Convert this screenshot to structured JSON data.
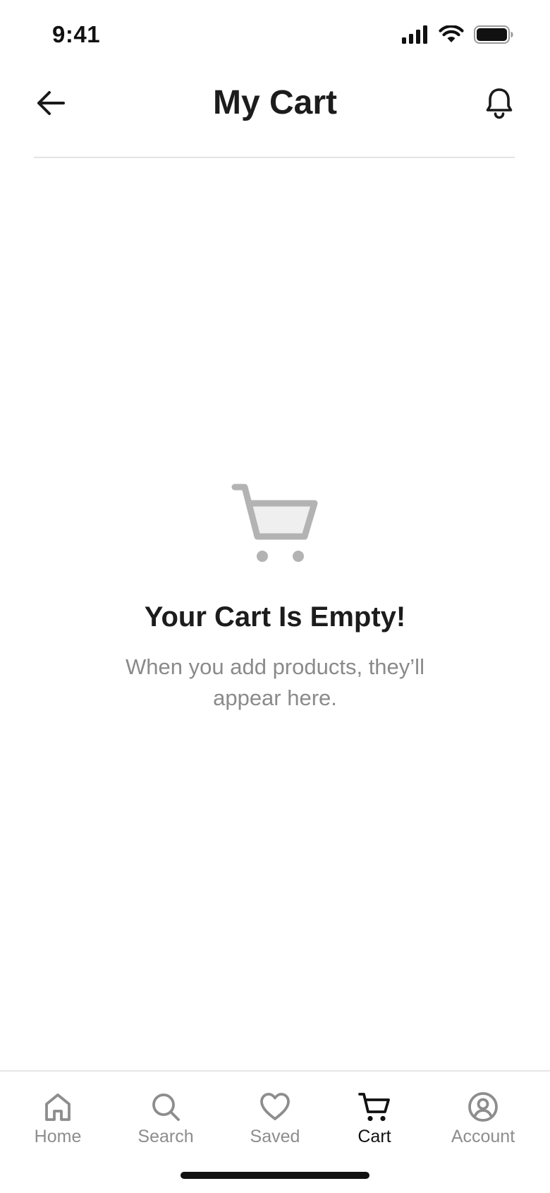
{
  "status_bar": {
    "time": "9:41",
    "icons": [
      "cellular-signal-icon",
      "wifi-icon",
      "battery-icon"
    ]
  },
  "header": {
    "title": "My Cart",
    "back_icon": "arrow-left-icon",
    "notification_icon": "bell-icon"
  },
  "empty_state": {
    "icon": "shopping-cart-icon",
    "title": "Your Cart Is Empty!",
    "subtitle": "When you add products, they’ll appear here."
  },
  "tab_bar": {
    "tabs": [
      {
        "label": "Home",
        "icon": "home-icon",
        "active": false
      },
      {
        "label": "Search",
        "icon": "search-icon",
        "active": false
      },
      {
        "label": "Saved",
        "icon": "heart-icon",
        "active": false
      },
      {
        "label": "Cart",
        "icon": "cart-icon",
        "active": true
      },
      {
        "label": "Account",
        "icon": "account-icon",
        "active": false
      }
    ]
  },
  "colors": {
    "text_primary": "#1c1c1c",
    "text_secondary": "#8a8a8a",
    "tab_inactive": "#8d8d8d",
    "tab_active": "#111111",
    "illustration_gray": "#b3b3b3",
    "illustration_fill": "#efefef",
    "divider": "#e4e4e4"
  }
}
